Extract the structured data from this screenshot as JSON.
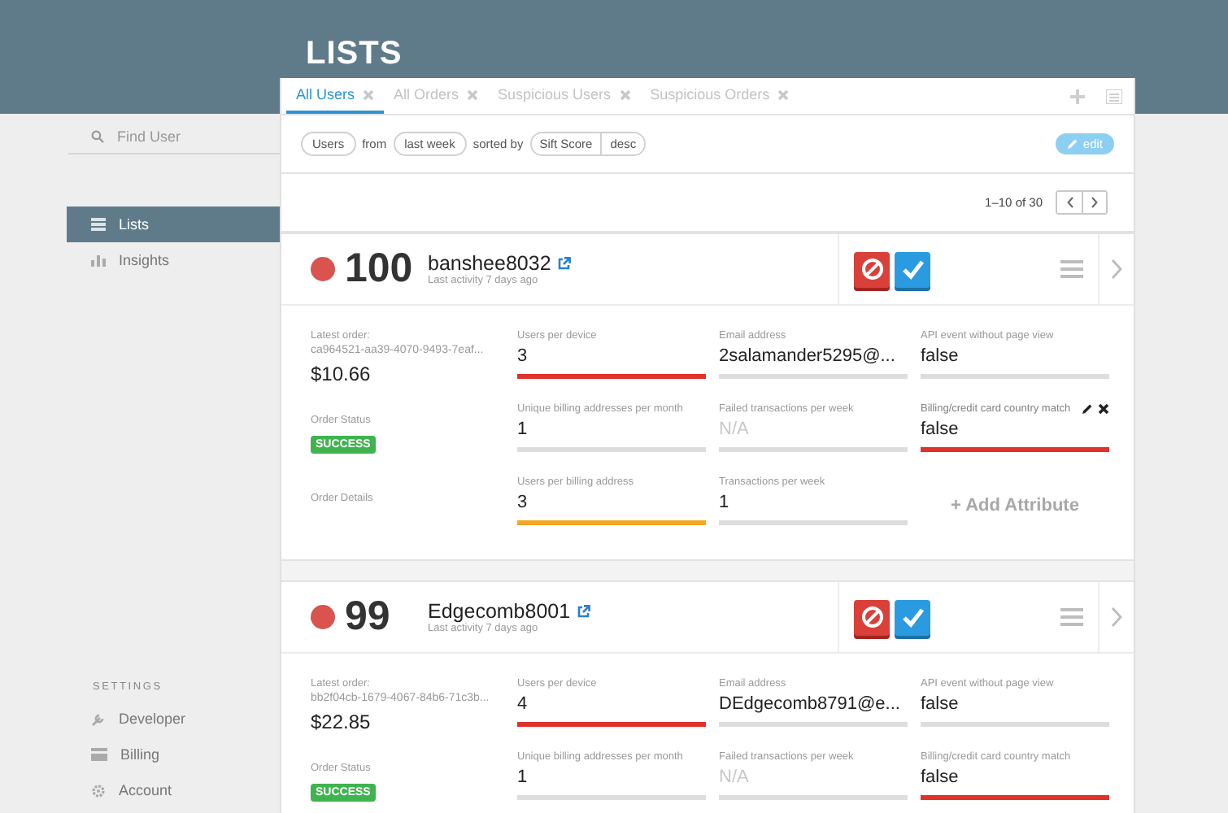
{
  "header": {
    "title": "LISTS"
  },
  "sidebar": {
    "search": {
      "placeholder": "Find User"
    },
    "items": [
      {
        "label": "Lists",
        "selected": true
      },
      {
        "label": "Insights",
        "selected": false
      }
    ],
    "settings_heading": "SETTINGS",
    "settings_items": [
      {
        "label": "Developer",
        "selected": false
      },
      {
        "label": "Billing",
        "selected": false
      },
      {
        "label": "Account",
        "selected": false
      }
    ]
  },
  "tabs": [
    {
      "label": "All Users",
      "selected": true
    },
    {
      "label": "All Orders",
      "selected": false
    },
    {
      "label": "Suspicious Users",
      "selected": false
    },
    {
      "label": "Suspicious Orders",
      "selected": false
    }
  ],
  "filters": [
    {
      "kind": "chip",
      "text": "Users"
    },
    {
      "kind": "text",
      "text": "from"
    },
    {
      "kind": "chip",
      "text": "last week"
    },
    {
      "kind": "text",
      "text": "sorted by"
    },
    {
      "kind": "segmented",
      "parts": [
        "Sift Score",
        "desc"
      ]
    }
  ],
  "edit_button": "edit",
  "pagination": {
    "range": "1–10 of 30"
  },
  "users": [
    {
      "score": "100",
      "name": "banshee8032",
      "activity": "Last activity 7 days ago",
      "order_label": "Latest order:",
      "order_id": "ca964521-aa39-4070-9493-7eaf...",
      "amount": "$10.66",
      "status_label": "Order Status",
      "status": "SUCCESS",
      "details_label": "Order Details",
      "add_attribute": "+ Add Attribute",
      "attributes": [
        {
          "label": "Users per device",
          "value": "3",
          "color": "#e0312b",
          "muted": false,
          "editable": false
        },
        {
          "label": "Email address",
          "value": "2salamander5295@...",
          "color": "#dddddd",
          "muted": false,
          "editable": false
        },
        {
          "label": "API event without page view",
          "value": "false",
          "color": "#dddddd",
          "muted": false,
          "editable": false
        },
        {
          "label": "Unique billing addresses per month",
          "value": "1",
          "color": "#dddddd",
          "muted": false,
          "editable": false
        },
        {
          "label": "Failed transactions per week",
          "value": "N/A",
          "color": "#dddddd",
          "muted": true,
          "editable": false
        },
        {
          "label": "Billing/credit card country match",
          "value": "false",
          "color": "#e0312b",
          "muted": false,
          "editable": true
        },
        {
          "label": "Users per billing address",
          "value": "3",
          "color": "#f5a623",
          "muted": false,
          "editable": false
        },
        {
          "label": "Transactions per week",
          "value": "1",
          "color": "#dddddd",
          "muted": false,
          "editable": false
        }
      ]
    },
    {
      "score": "99",
      "name": "Edgecomb8001",
      "activity": "Last activity 7 days ago",
      "order_label": "Latest order:",
      "order_id": "bb2f04cb-1679-4067-84b6-71c3b...",
      "amount": "$22.85",
      "status_label": "Order Status",
      "status": "SUCCESS",
      "attributes": [
        {
          "label": "Users per device",
          "value": "4",
          "color": "#e0312b",
          "muted": false,
          "editable": false
        },
        {
          "label": "Email address",
          "value": "DEdgecomb8791@e...",
          "color": "#dddddd",
          "muted": false,
          "editable": false
        },
        {
          "label": "API event without page view",
          "value": "false",
          "color": "#dddddd",
          "muted": false,
          "editable": false
        },
        {
          "label": "Unique billing addresses per month",
          "value": "1",
          "color": "#dddddd",
          "muted": false,
          "editable": false
        },
        {
          "label": "Failed transactions per week",
          "value": "N/A",
          "color": "#dddddd",
          "muted": true,
          "editable": false
        },
        {
          "label": "Billing/credit card country match",
          "value": "false",
          "color": "#e0312b",
          "muted": false,
          "editable": false
        }
      ]
    }
  ]
}
